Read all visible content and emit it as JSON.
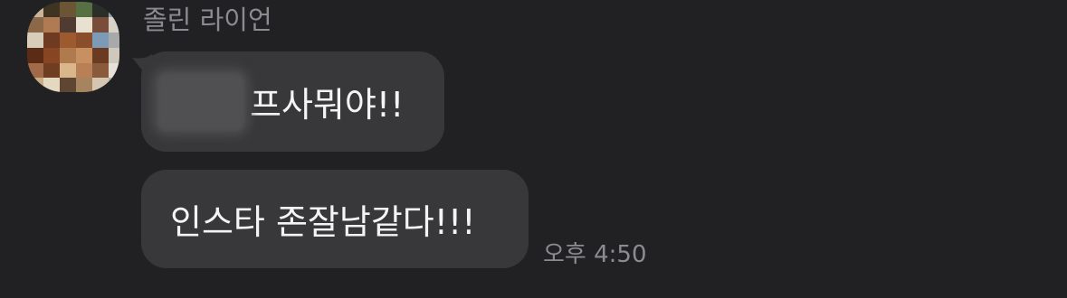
{
  "chat": {
    "sender_name": "졸린 라이언",
    "messages": [
      {
        "text": "프사뭐야!!",
        "has_blurred_prefix": true
      },
      {
        "text": "인스타 존잘남같다!!!"
      }
    ],
    "last_timestamp": "오후 4:50"
  },
  "colors": {
    "background": "#212124",
    "bubble": "#38383b",
    "message_text": "#f4f4f6",
    "meta_text": "#8c8c90"
  },
  "icons": {
    "avatar": "pixelated-profile-photo"
  }
}
